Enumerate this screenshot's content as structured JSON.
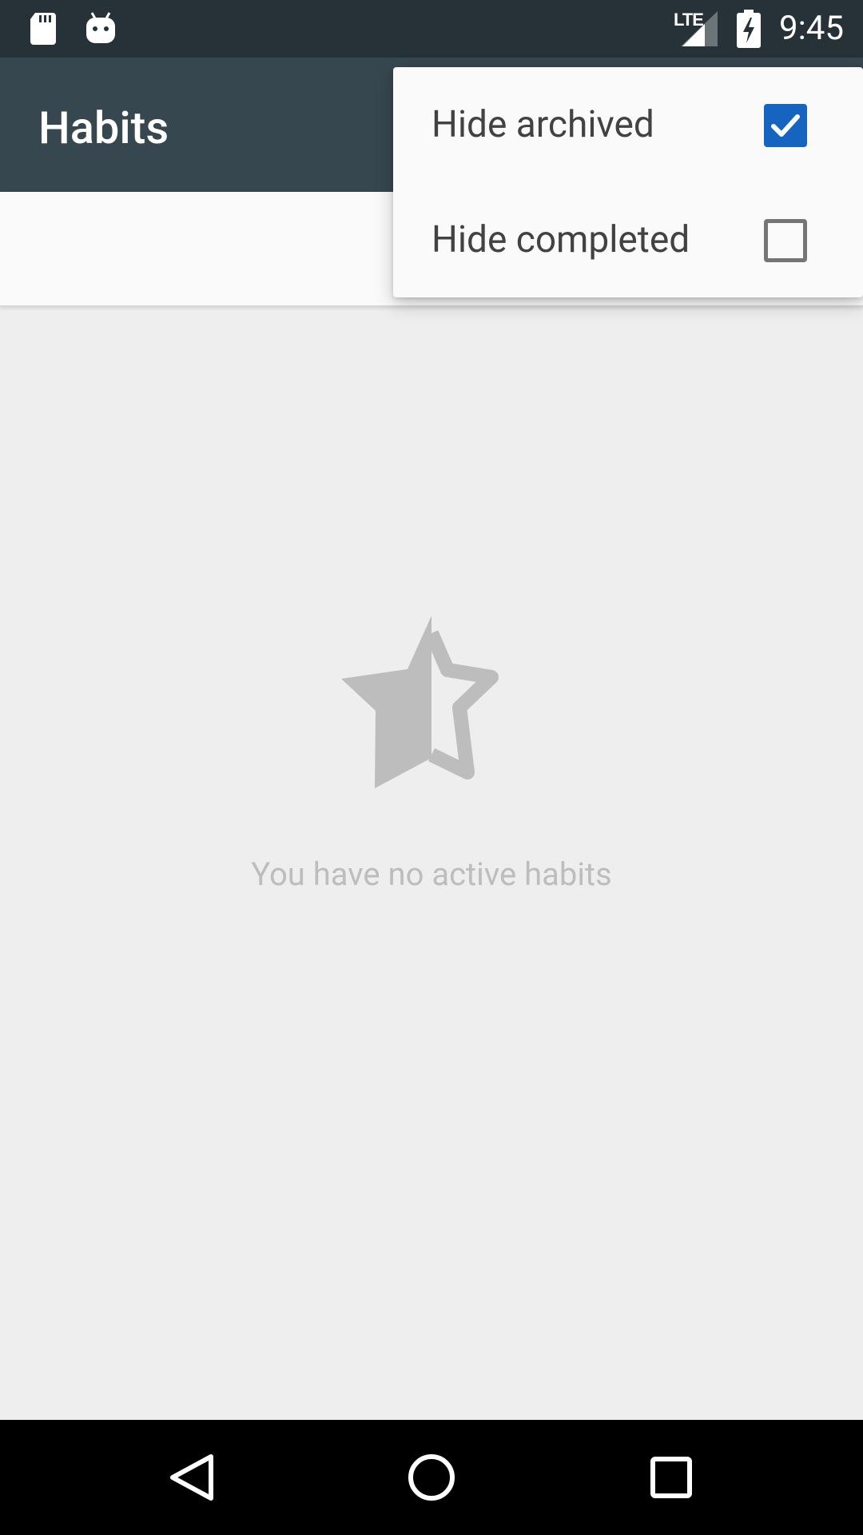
{
  "status_bar": {
    "time": "9:45",
    "network_label": "LTE",
    "icons": [
      "sd-card-icon",
      "android-debug-icon",
      "signal-icon",
      "battery-charging-icon"
    ]
  },
  "app_bar": {
    "title": "Habits"
  },
  "overflow_menu": {
    "items": [
      {
        "label": "Hide archived",
        "checked": true
      },
      {
        "label": "Hide completed",
        "checked": false
      }
    ]
  },
  "empty_state": {
    "icon": "half-star-icon",
    "message": "You have no active habits"
  },
  "nav_bar": {
    "icons": [
      "back-icon",
      "home-icon",
      "recents-icon"
    ]
  },
  "colors": {
    "status_bar": "#263238",
    "app_bar": "#37474f",
    "background": "#eeeeee",
    "accent": "#1565c0"
  }
}
